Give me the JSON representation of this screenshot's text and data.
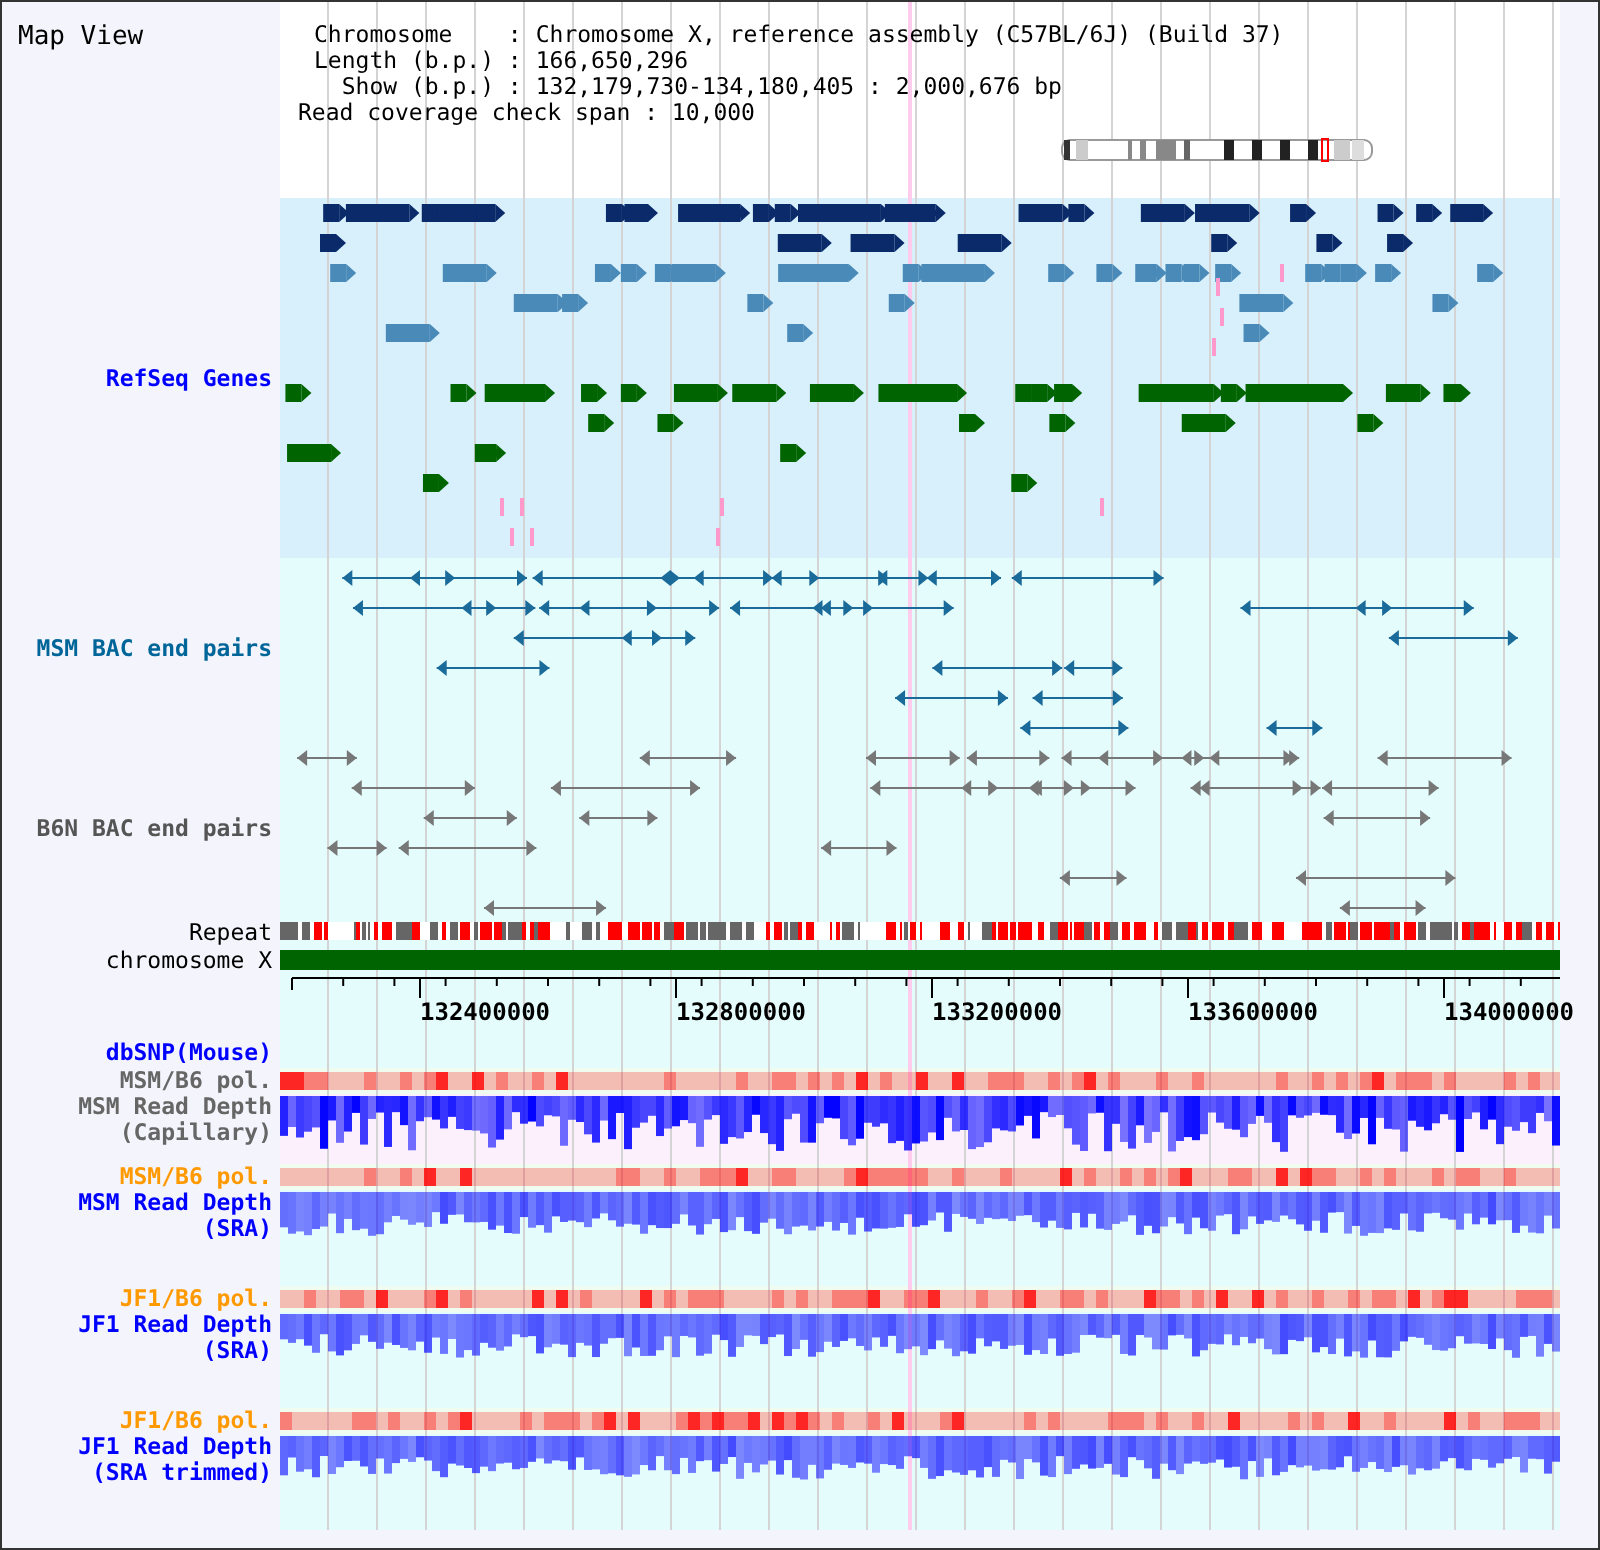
{
  "title": "Map View",
  "info": [
    {
      "label": "Chromosome    :",
      "value": "Chromosome X, reference assembly (C57BL/6J) (Build 37)"
    },
    {
      "label": "Length (b.p.) :",
      "value": "166,650,296"
    },
    {
      "label": "Show (b.p.) :",
      "value": "132,179,730-134,180,405 : 2,000,676 bp"
    }
  ],
  "coverage_span": "Read coverage check span : 10,000",
  "tracks": [
    {
      "kind": "genes",
      "label": "RefSeq Genes",
      "color": "#0000ff"
    },
    {
      "kind": "pairs",
      "label": "MSM BAC end pairs",
      "color": "#006699"
    },
    {
      "kind": "pairs",
      "label": "B6N BAC end pairs",
      "color": "#555555"
    },
    {
      "kind": "repeat",
      "label": "Repeat",
      "color": "#000000"
    },
    {
      "kind": "chromosome",
      "label": "chromosome X",
      "color": "#000000"
    },
    {
      "kind": "axis",
      "ticks": [
        "132400000",
        "132800000",
        "133200000",
        "133600000",
        "134000000"
      ]
    },
    {
      "kind": "snp",
      "label": "dbSNP(Mouse)",
      "color": "#0000ff"
    },
    {
      "kind": "pol",
      "label": "MSM/B6 pol.",
      "color": "#666666"
    },
    {
      "kind": "capillary",
      "label": "MSM Read Depth\n(Capillary)",
      "color": "#666666"
    },
    {
      "kind": "pol",
      "label": "MSM/B6 pol.",
      "color": "#ff9900"
    },
    {
      "kind": "depth",
      "label": "MSM Read Depth\n(SRA)",
      "color": "#0000ff"
    },
    {
      "kind": "pol",
      "label": "JF1/B6 pol.",
      "color": "#ff9900"
    },
    {
      "kind": "depth",
      "label": "JF1 Read Depth\n(SRA)",
      "color": "#0000ff"
    },
    {
      "kind": "pol",
      "label": "JF1/B6 pol.",
      "color": "#ff9900"
    },
    {
      "kind": "depth",
      "label": "JF1 Read Depth\n(SRA trimmed)",
      "color": "#0000ff"
    }
  ]
}
